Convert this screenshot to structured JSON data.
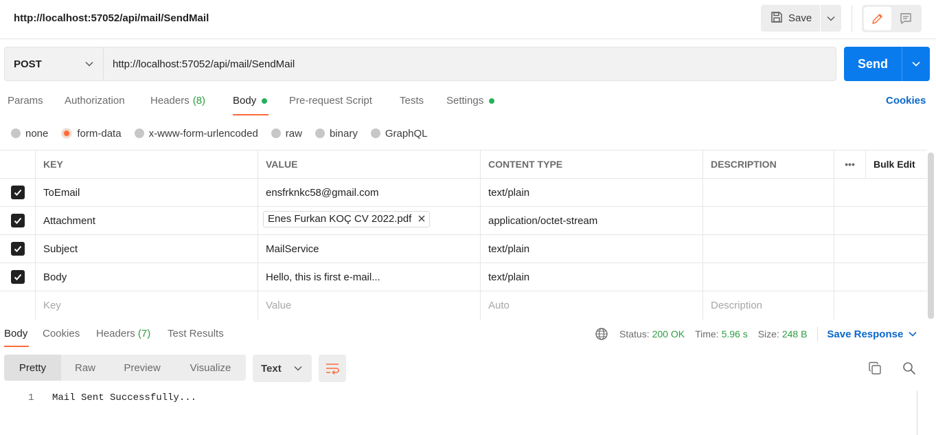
{
  "header": {
    "title": "http://localhost:57052/api/mail/SendMail",
    "save_label": "Save"
  },
  "request": {
    "method": "POST",
    "url": "http://localhost:57052/api/mail/SendMail",
    "send_label": "Send",
    "tabs": [
      {
        "label": "Params"
      },
      {
        "label": "Authorization"
      },
      {
        "label": "Headers",
        "count": "(8)"
      },
      {
        "label": "Body",
        "active": true,
        "dot": true
      },
      {
        "label": "Pre-request Script"
      },
      {
        "label": "Tests"
      },
      {
        "label": "Settings",
        "dot": true
      }
    ],
    "cookies_label": "Cookies",
    "body_types": [
      {
        "label": "none"
      },
      {
        "label": "form-data",
        "selected": true
      },
      {
        "label": "x-www-form-urlencoded"
      },
      {
        "label": "raw"
      },
      {
        "label": "binary"
      },
      {
        "label": "GraphQL"
      }
    ]
  },
  "params_table": {
    "headers": {
      "key": "KEY",
      "value": "VALUE",
      "content_type": "CONTENT TYPE",
      "description": "DESCRIPTION",
      "more": "•••",
      "bulk_edit": "Bulk Edit"
    },
    "rows": [
      {
        "checked": true,
        "key": "ToEmail",
        "value": "ensfrknkc58@gmail.com",
        "content_type": "text/plain",
        "description": ""
      },
      {
        "checked": true,
        "key": "Attachment",
        "value": "Enes Furkan KOÇ CV 2022.pdf",
        "is_file": true,
        "content_type": "application/octet-stream",
        "description": ""
      },
      {
        "checked": true,
        "key": "Subject",
        "value": "MailService",
        "content_type": "text/plain",
        "description": ""
      },
      {
        "checked": true,
        "key": "Body",
        "value": "Hello, this is first e-mail...",
        "content_type": "text/plain",
        "description": ""
      }
    ],
    "placeholders": {
      "key": "Key",
      "value": "Value",
      "content_type": "Auto",
      "description": "Description"
    }
  },
  "response": {
    "tabs": [
      {
        "label": "Body",
        "active": true
      },
      {
        "label": "Cookies"
      },
      {
        "label": "Headers",
        "count": "(7)"
      },
      {
        "label": "Test Results"
      }
    ],
    "status_label": "Status:",
    "status_value": "200 OK",
    "time_label": "Time:",
    "time_value": "5.96 s",
    "size_label": "Size:",
    "size_value": "248 B",
    "save_response_label": "Save Response",
    "view_modes": [
      "Pretty",
      "Raw",
      "Preview",
      "Visualize"
    ],
    "format": "Text",
    "lines": [
      {
        "num": "1",
        "text": "Mail Sent Successfully..."
      }
    ]
  },
  "colors": {
    "accent": "#ff6c37",
    "send_blue": "#097bed",
    "link_blue": "#0b68c9",
    "success_green": "#2a9d40"
  }
}
